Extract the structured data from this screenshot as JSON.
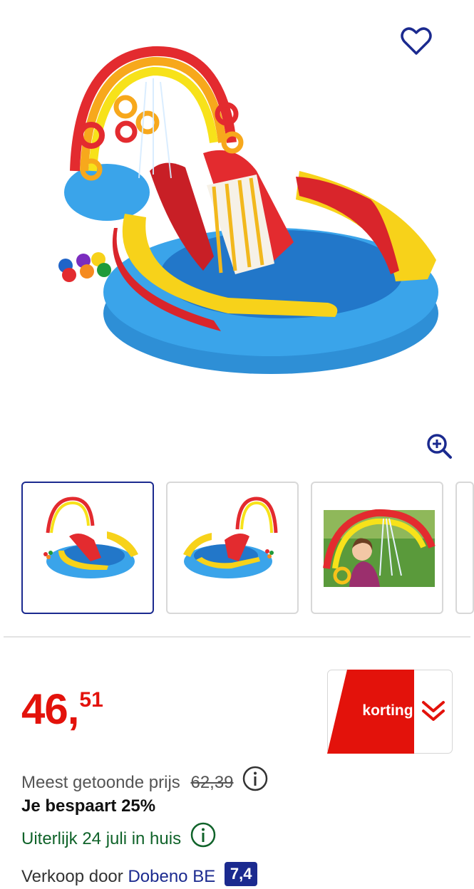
{
  "product": {
    "images": [
      {
        "name": "pool-main"
      },
      {
        "name": "pool-side"
      },
      {
        "name": "pool-child-photo"
      }
    ]
  },
  "price": {
    "euros": "46",
    "separator": ",",
    "cents": "51",
    "color": "#e3120b"
  },
  "badge": {
    "label": "korting",
    "color": "#e3120b"
  },
  "price_info": {
    "meest_label": "Meest getoonde prijs",
    "old_price": "62,39",
    "savings": "Je bespaart 25%",
    "delivery": "Uiterlijk 24 juli in huis"
  },
  "seller": {
    "prefix": "Verkoop door",
    "name": "Dobeno BE",
    "score": "7,4"
  },
  "icons": {
    "favorite": "heart-icon",
    "zoom": "zoom-in-icon",
    "info": "info-icon",
    "expand": "chevron-double-down-icon"
  }
}
